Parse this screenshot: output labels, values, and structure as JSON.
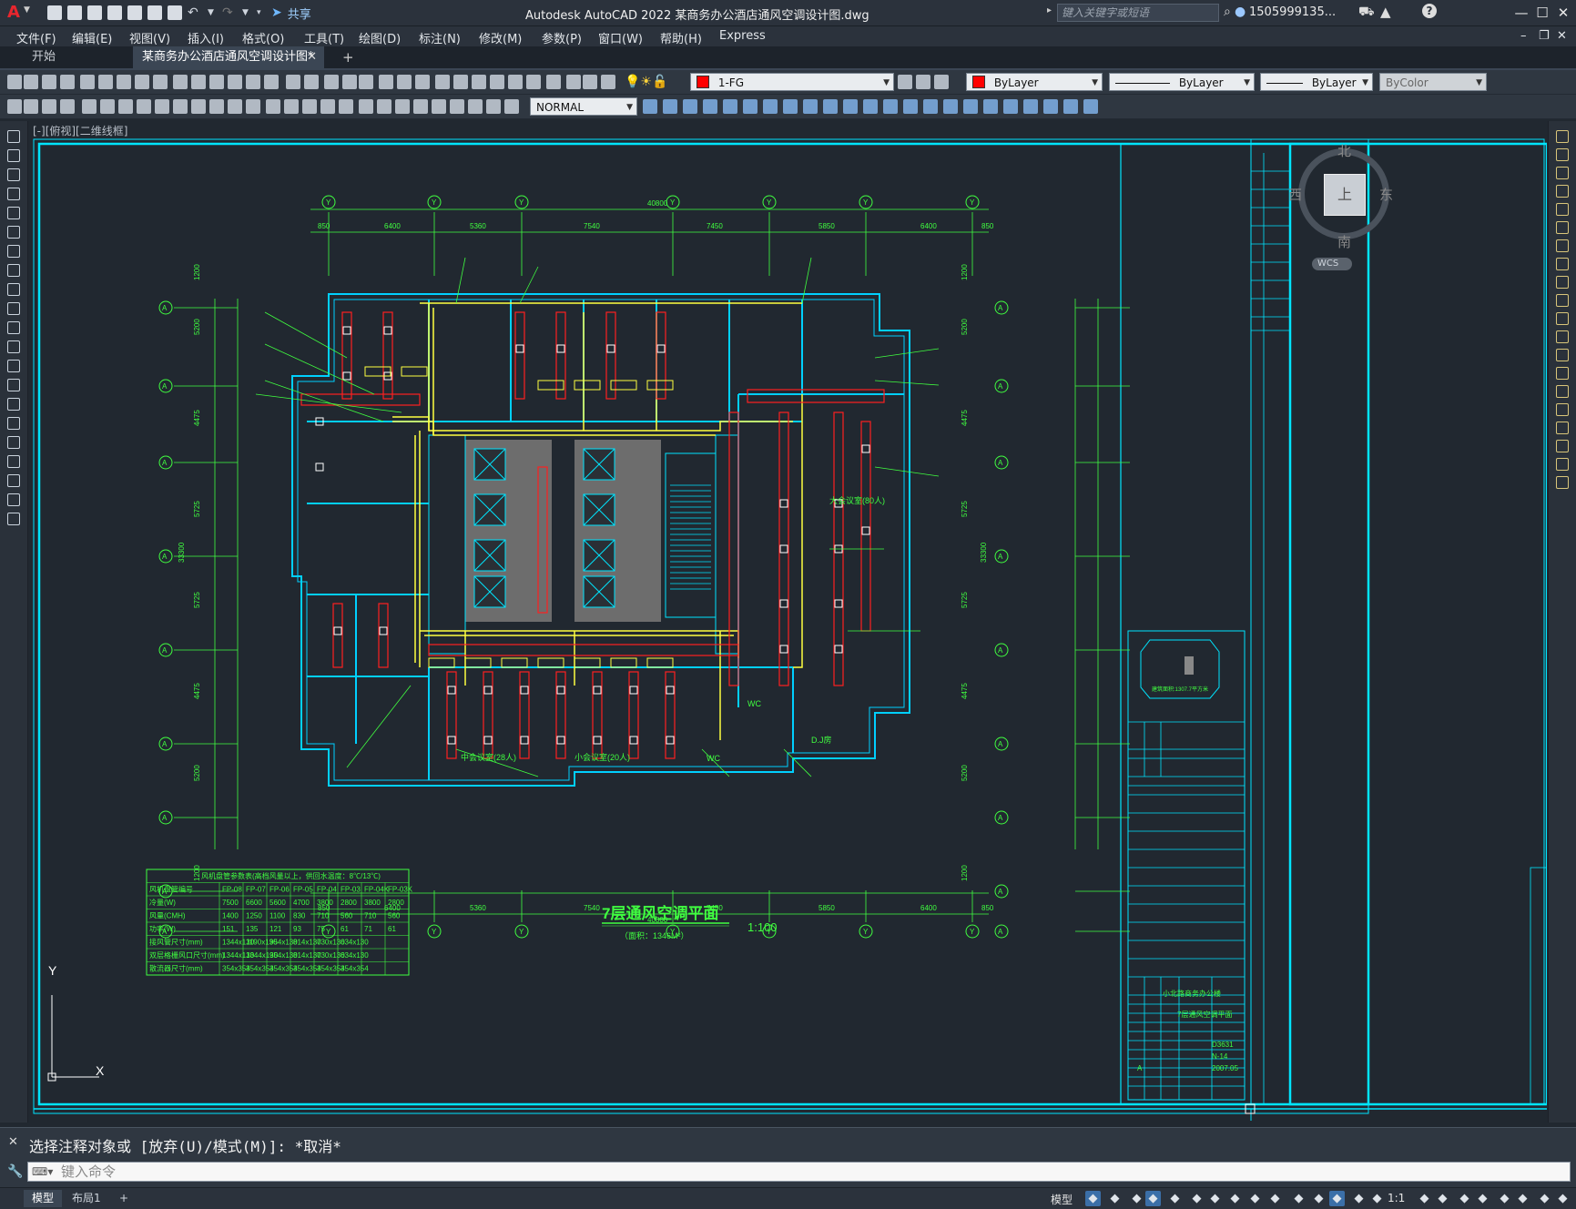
{
  "app": {
    "logo": "A",
    "title": "Autodesk AutoCAD 2022    某商务办公酒店通风空调设计图.dwg",
    "share": "共享",
    "search_placeholder": "键入关键字或短语",
    "user": "1505999135...",
    "icons": [
      "new-icon",
      "open-icon",
      "save-icon",
      "saveas-icon",
      "open-web-icon",
      "save-web-icon",
      "plot-icon",
      "undo-icon",
      "redo-icon",
      "share-icon",
      "search-icon",
      "user-icon",
      "cart-icon",
      "a360-icon",
      "help-icon",
      "minimize-icon",
      "restore-icon",
      "close-icon"
    ]
  },
  "menu": [
    "文件(F)",
    "编辑(E)",
    "视图(V)",
    "插入(I)",
    "格式(O)",
    "工具(T)",
    "绘图(D)",
    "标注(N)",
    "修改(M)",
    "参数(P)",
    "窗口(W)",
    "帮助(H)",
    "Express"
  ],
  "tabs": [
    {
      "label": "开始",
      "active": false
    },
    {
      "label": "某商务办公酒店通风空调设计图*",
      "active": true
    }
  ],
  "toolbar": {
    "layer": "1-FG",
    "color": "ByLayer",
    "linetype": "ByLayer",
    "lineweight": "ByLayer",
    "plotstyle": "ByColor",
    "dimstyle": "NORMAL",
    "layer_color": "#ff0000"
  },
  "viewport_label": "[-][俯视][二维线框]",
  "viewcube": {
    "north": "北",
    "south": "南",
    "east": "东",
    "west": "西",
    "face": "上",
    "wcs": "WCS"
  },
  "drawing": {
    "title": "7层通风空调平面",
    "area": "（面积：1346M²）",
    "scale": "1:100",
    "axis_letters_left": [
      "A",
      "A",
      "A",
      "A",
      "A",
      "A",
      "A",
      "A",
      "A"
    ],
    "axis_numbers_top": [
      "Y",
      "Y",
      "Y",
      "Y",
      "Y",
      "Y",
      "Y"
    ],
    "dims_top": [
      "850",
      "6400",
      "5360",
      "7540",
      "7450",
      "5850",
      "6400",
      "850"
    ],
    "total_top": "40800",
    "dims_left": [
      "1200",
      "5200",
      "4475",
      "5725",
      "5725",
      "4475",
      "5200",
      "1200"
    ],
    "total_left": "33300",
    "rooms": [
      "大会议室(80人)",
      "中会议室(28人)",
      "小会议室(20人)",
      "D.J房",
      "WC",
      "WC"
    ],
    "colors": {
      "frame": "#00e5ff",
      "duct": "#ff2020",
      "pipe": "#ffff40",
      "text": "#40ff40",
      "wall": "#00d0ff",
      "core": "#808080"
    }
  },
  "equipment_table": {
    "title": "风机盘管参数表(高档风量以上，供回水温度：8℃/13℃)",
    "columns": [
      "风机盘管编号",
      "FP-08",
      "FP-07",
      "FP-06",
      "FP-05",
      "FP-04",
      "FP-03",
      "FP-04K",
      "FP-03K"
    ],
    "rows": [
      [
        "冷量(W)",
        "7500",
        "6600",
        "5600",
        "4700",
        "3800",
        "2800",
        "3800",
        "2800"
      ],
      [
        "风量(CMH)",
        "1400",
        "1250",
        "1100",
        "830",
        "710",
        "560",
        "710",
        "560"
      ],
      [
        "功率(W)",
        "151",
        "135",
        "121",
        "93",
        "75",
        "61",
        "71",
        "61"
      ],
      [
        "接风管尺寸(mm)",
        "1344x130",
        "1190x130",
        "954x130",
        "814x130",
        "730x130",
        "634x130",
        "",
        ""
      ],
      [
        "双层格栅风口尺寸(mm)",
        "1344x130",
        "1344x130",
        "954x130",
        "814x130",
        "730x130",
        "634x130",
        "",
        ""
      ],
      [
        "散流器尺寸(mm)",
        "354x354",
        "354x354",
        "354x354",
        "354x354",
        "354x354",
        "354x354",
        "",
        ""
      ]
    ]
  },
  "title_block": {
    "project": "小北路商务办公楼",
    "drawing_name": "7层通风空调平面",
    "number": "D3631",
    "sheet": "N-14",
    "rev": "A",
    "date": "2007.05",
    "stamp_text": "建筑面积:1307.7平方米"
  },
  "command": {
    "history": "选择注释对象或 [放弃(U)/模式(M)]: *取消*",
    "placeholder": "键入命令"
  },
  "status": {
    "layout_tabs": [
      "模型",
      "布局1"
    ],
    "model": "模型",
    "scale": "1:1"
  }
}
